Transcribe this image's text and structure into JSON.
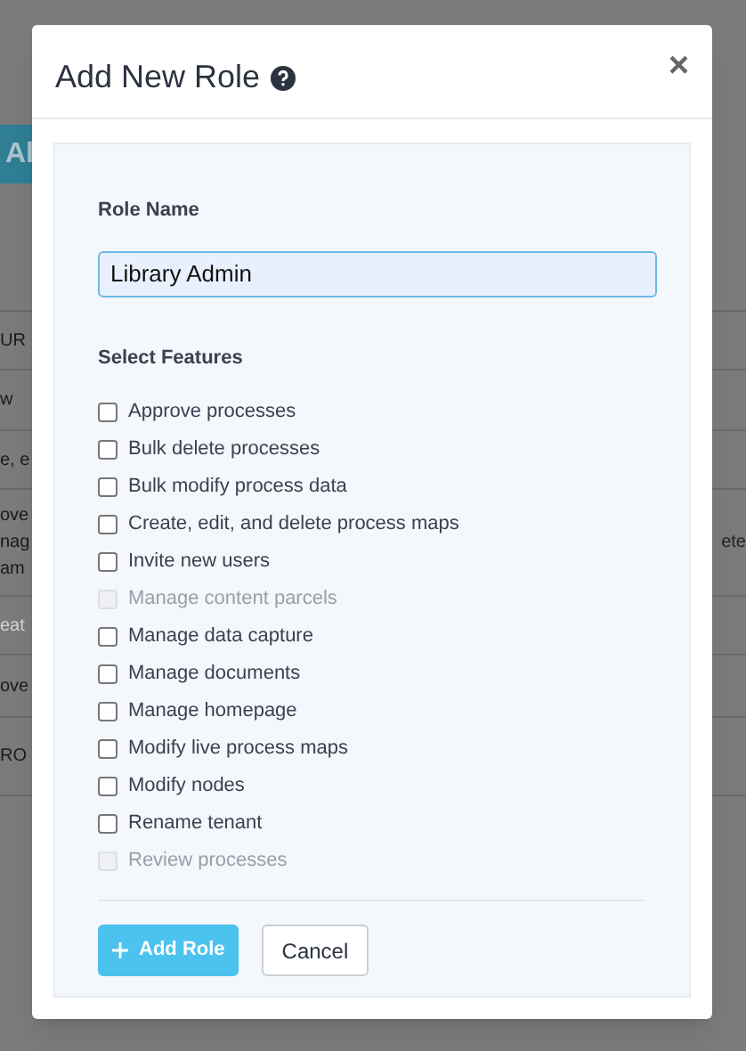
{
  "backdrop": {
    "header_fragment": "Al",
    "left_fragments": [
      {
        "text": "UR",
        "muted": false
      },
      {
        "text": "w",
        "muted": false
      },
      {
        "text": "e, e",
        "muted": false
      },
      {
        "text": "ove\nnag\nam",
        "muted": false
      },
      {
        "text": "eat",
        "muted": true
      },
      {
        "text": "ove",
        "muted": false
      },
      {
        "text": "RO",
        "muted": false
      }
    ],
    "right_fragment": "ete"
  },
  "dialog": {
    "title": "Add New Role",
    "close": "×",
    "role_name": {
      "label": "Role Name",
      "value": "Library Admin"
    },
    "features_label": "Select Features",
    "features": [
      {
        "label": "Approve processes",
        "checked": false,
        "disabled": false
      },
      {
        "label": "Bulk delete processes",
        "checked": false,
        "disabled": false
      },
      {
        "label": "Bulk modify process data",
        "checked": false,
        "disabled": false
      },
      {
        "label": "Create, edit, and delete process maps",
        "checked": false,
        "disabled": false
      },
      {
        "label": "Invite new users",
        "checked": false,
        "disabled": false
      },
      {
        "label": "Manage content parcels",
        "checked": false,
        "disabled": true
      },
      {
        "label": "Manage data capture",
        "checked": false,
        "disabled": false
      },
      {
        "label": "Manage documents",
        "checked": false,
        "disabled": false
      },
      {
        "label": "Manage homepage",
        "checked": false,
        "disabled": false
      },
      {
        "label": "Modify live process maps",
        "checked": false,
        "disabled": false
      },
      {
        "label": "Modify nodes",
        "checked": false,
        "disabled": false
      },
      {
        "label": "Rename tenant",
        "checked": false,
        "disabled": false
      },
      {
        "label": "Review processes",
        "checked": false,
        "disabled": true
      }
    ],
    "buttons": [
      {
        "label": "Add Role",
        "kind": "primary"
      },
      {
        "label": "Cancel",
        "kind": "secondary"
      }
    ]
  }
}
